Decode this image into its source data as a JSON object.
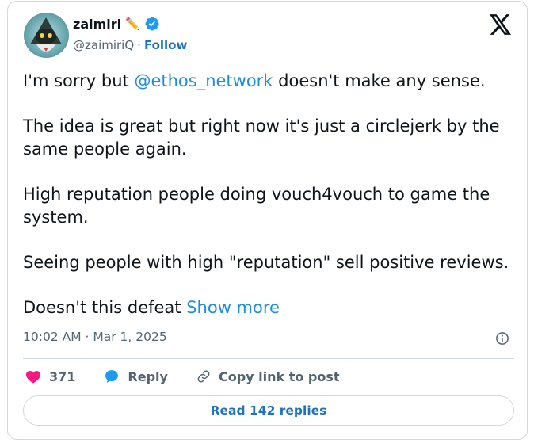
{
  "author": {
    "display_name": "zaimiri",
    "name_emoji": "✏️",
    "handle": "@zaimiriQ",
    "separator": "·",
    "follow_label": "Follow",
    "verified_color": "#1d9bf0"
  },
  "brand_icon": "x-logo-icon",
  "tweet": {
    "line1_before": "I'm sorry but ",
    "mention": "@ethos_network",
    "line1_after": " doesn't make any sense.",
    "para2": "The idea is great but right now it's just a circlejerk by the same people again.",
    "para3": "High reputation people doing vouch4vouch to game the system.",
    "para4": "Seeing people with high \"reputation\" sell positive reviews.",
    "para5_before": "Doesn't this defeat ",
    "show_more": "Show more"
  },
  "timestamp": "10:02 AM · Mar 1, 2025",
  "actions": {
    "like_count": "371",
    "reply_label": "Reply",
    "copy_label": "Copy link to post"
  },
  "read_replies_label": "Read 142 replies",
  "colors": {
    "accent": "#1d9bf0",
    "like": "#f91880",
    "muted": "#536471"
  }
}
